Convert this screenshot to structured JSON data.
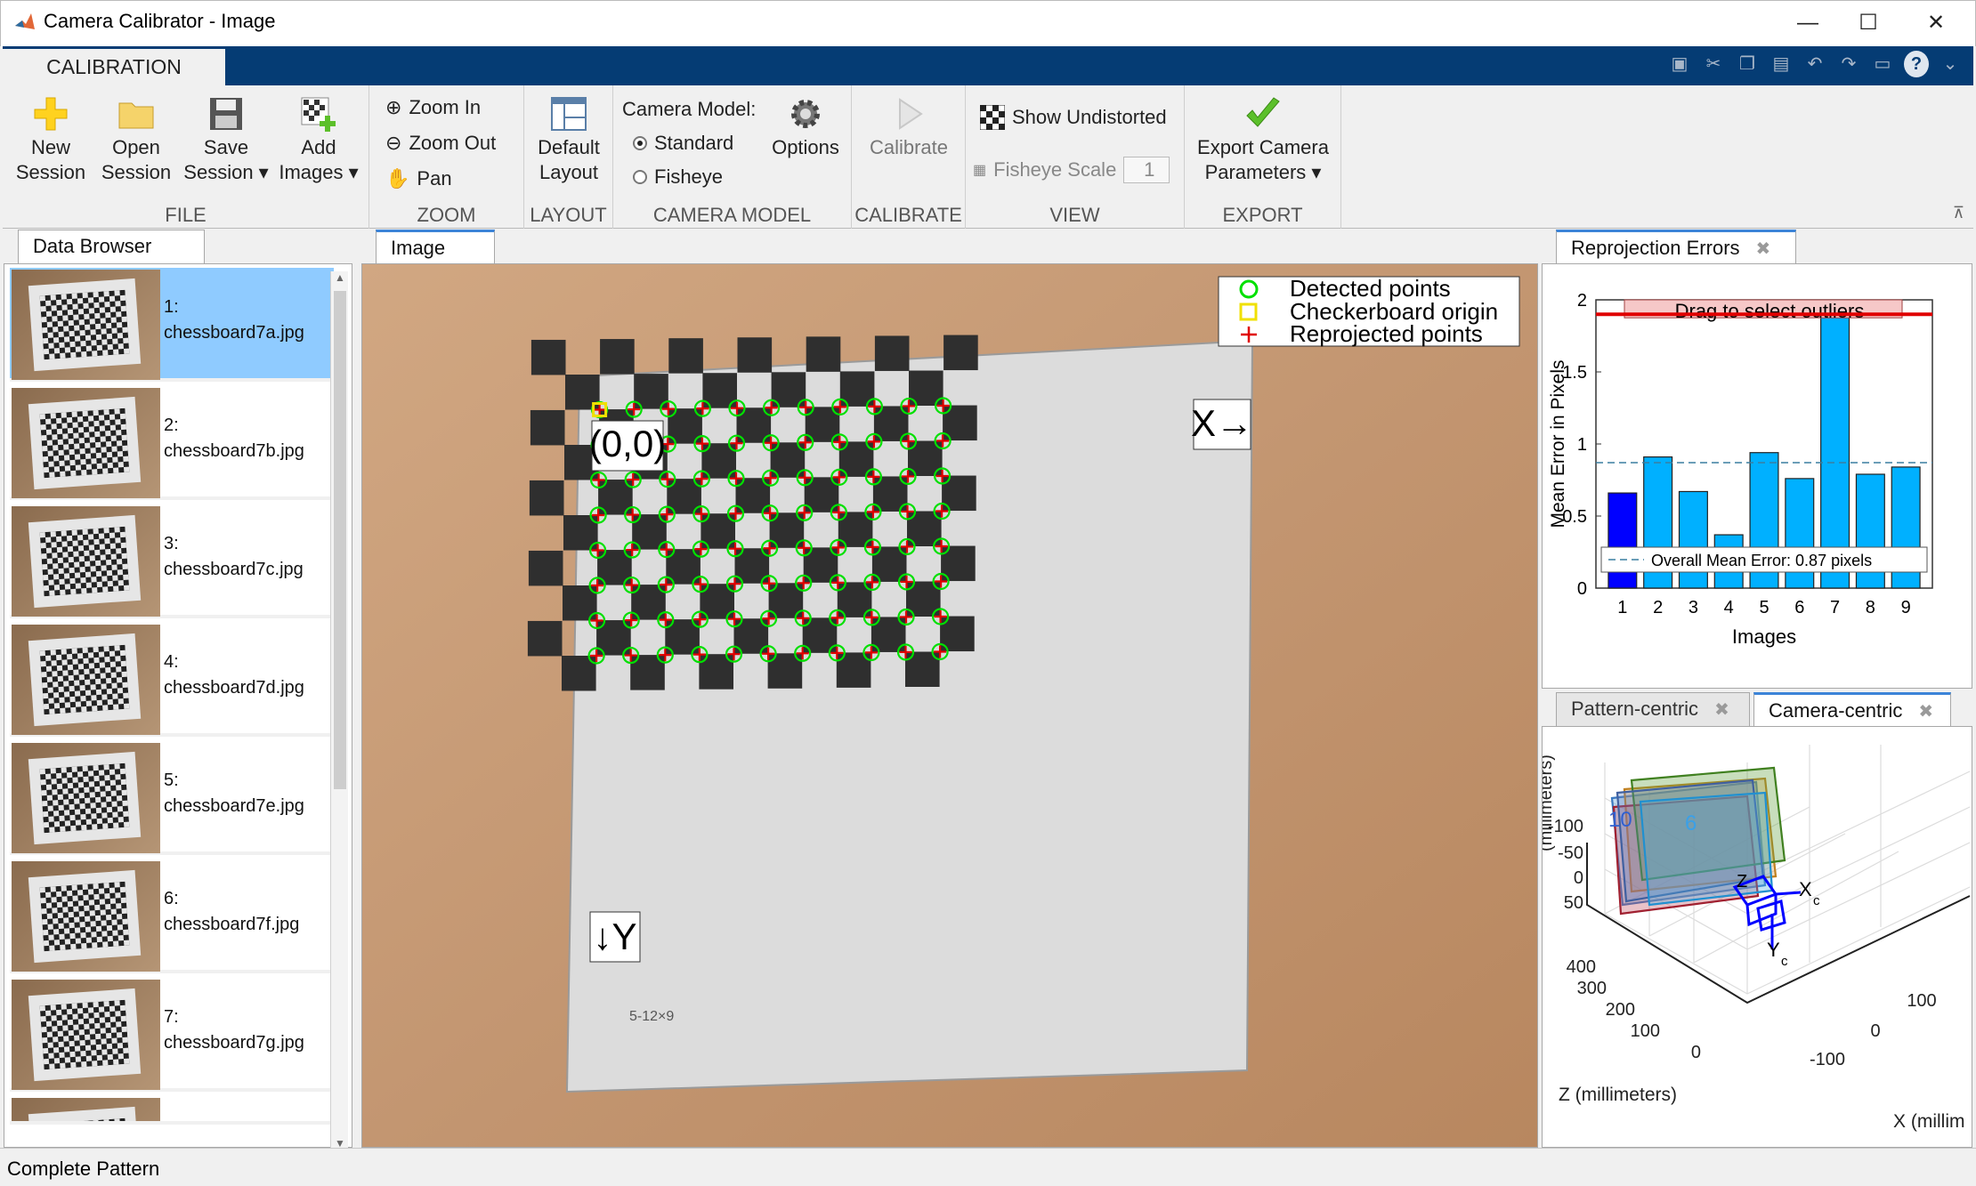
{
  "window": {
    "title": "Camera Calibrator - Image",
    "minimize": "—",
    "maximize": "☐",
    "close": "✕"
  },
  "ribbon": {
    "tab": "CALIBRATION",
    "file": {
      "label": "FILE",
      "new": [
        "New",
        "Session"
      ],
      "open": [
        "Open",
        "Session"
      ],
      "save": [
        "Save",
        "Session ▾"
      ],
      "add": [
        "Add",
        "Images ▾"
      ]
    },
    "zoom": {
      "label": "ZOOM",
      "zoom_in": "Zoom In",
      "zoom_out": "Zoom Out",
      "pan": "Pan"
    },
    "layout": {
      "label": "LAYOUT",
      "default": [
        "Default",
        "Layout"
      ]
    },
    "camera_model": {
      "label": "CAMERA MODEL",
      "title": "Camera Model:",
      "standard": "Standard",
      "fisheye": "Fisheye",
      "options": "Options",
      "selected": "Standard"
    },
    "calibrate": {
      "label": "CALIBRATE",
      "button": "Calibrate"
    },
    "view": {
      "label": "VIEW",
      "show_undistorted": "Show Undistorted",
      "fisheye_scale": "Fisheye Scale",
      "fisheye_scale_value": "1"
    },
    "export": {
      "label": "EXPORT",
      "button": [
        "Export Camera",
        "Parameters ▾"
      ]
    }
  },
  "data_browser": {
    "tab": "Data Browser",
    "items": [
      {
        "index": "1:",
        "file": "chessboard7a.jpg",
        "selected": true
      },
      {
        "index": "2:",
        "file": "chessboard7b.jpg",
        "selected": false
      },
      {
        "index": "3:",
        "file": "chessboard7c.jpg",
        "selected": false
      },
      {
        "index": "4:",
        "file": "chessboard7d.jpg",
        "selected": false
      },
      {
        "index": "5:",
        "file": "chessboard7e.jpg",
        "selected": false
      },
      {
        "index": "6:",
        "file": "chessboard7f.jpg",
        "selected": false
      },
      {
        "index": "7:",
        "file": "chessboard7g.jpg",
        "selected": false
      }
    ]
  },
  "image_panel": {
    "tab": "Image",
    "legend": {
      "detected": "Detected points",
      "origin": "Checkerboard origin",
      "reprojected": "Reprojected points"
    },
    "origin_label": "(0,0)",
    "x_label": "X→",
    "y_label": "↓Y",
    "board_caption": "5-12×9",
    "grid": {
      "cols": 11,
      "rows": 8
    }
  },
  "reprojection": {
    "tab": "Reprojection Errors",
    "drag_hint": "Drag to select outliers",
    "overall_label": "Overall Mean Error: 0.87 pixels",
    "chart_data": {
      "type": "bar",
      "categories": [
        "1",
        "2",
        "3",
        "4",
        "5",
        "6",
        "7",
        "8",
        "9"
      ],
      "values": [
        0.66,
        0.91,
        0.67,
        0.37,
        0.94,
        0.76,
        1.92,
        0.79,
        0.84
      ],
      "highlighted_index": 0,
      "overall_mean": 0.87,
      "threshold": 1.9,
      "xlabel": "Images",
      "ylabel": "Mean Error in Pixels",
      "ylim": [
        0,
        2
      ],
      "yticks": [
        "0",
        "0.5",
        "1",
        "1.5",
        "2"
      ],
      "colors": {
        "bar": "#00b0ff",
        "selected": "#0000ff",
        "threshold": "#e00000",
        "mean": "#3a7fa0"
      }
    }
  },
  "extrinsics": {
    "tabs": [
      "Pattern-centric",
      "Camera-centric"
    ],
    "active": "Camera-centric",
    "z_axis": "Z (millimeters)",
    "x_axis": "X (millim",
    "y_axis_partial": "(millimeters)",
    "y_ticks": [
      "-100",
      "-50",
      "0",
      "50"
    ],
    "z_ticks": [
      "400",
      "300",
      "200",
      "100",
      "0"
    ],
    "x_ticks": [
      "100",
      "0",
      "-100"
    ],
    "plane_labels": [
      "10",
      "6"
    ],
    "camera_axes": {
      "z": "Z",
      "x": "X",
      "y": "Y",
      "sub": "c"
    }
  },
  "status": {
    "text": "Complete Pattern"
  }
}
